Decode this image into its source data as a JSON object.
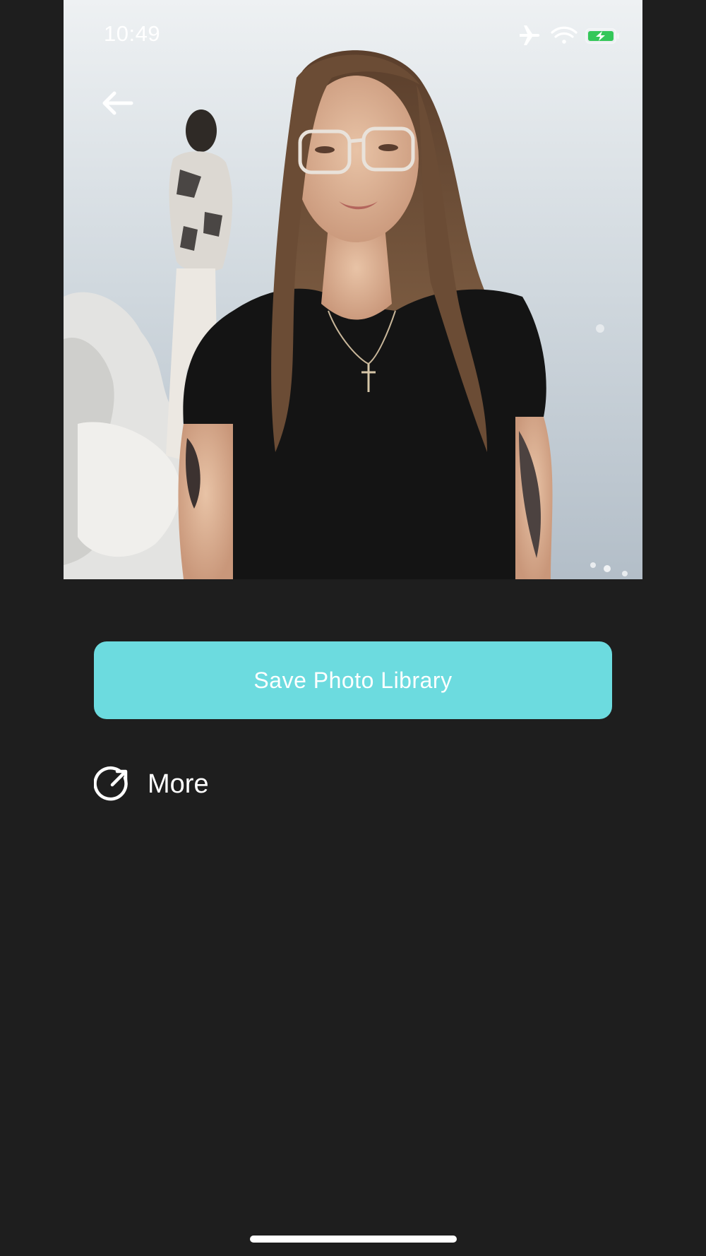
{
  "status_bar": {
    "time": "10:49",
    "icons": [
      "airplane-mode-icon",
      "wifi-icon",
      "battery-charging-icon"
    ],
    "battery_color": "#34c759"
  },
  "header": {
    "back_icon": "arrow-left-icon"
  },
  "preview": {
    "image": "photo-preview"
  },
  "actions": {
    "save_label": "Save Photo Library",
    "save_color": "#6cdbdf",
    "more_label": "More",
    "more_icon": "share-arrow-circle-icon"
  },
  "theme": {
    "background": "#1e1e1e"
  }
}
